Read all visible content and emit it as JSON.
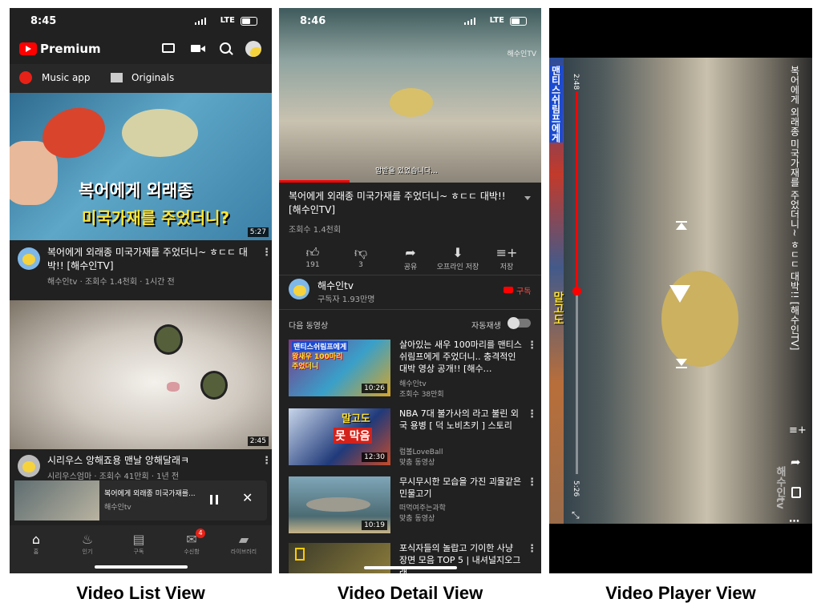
{
  "captions": {
    "list": "Video List View",
    "detail": "Video Detail View",
    "player": "Video Player View"
  },
  "list_view": {
    "time": "8:45",
    "network": "LTE",
    "brand": "Premium",
    "chips": [
      {
        "label": "Music app",
        "icon": "music-icon"
      },
      {
        "label": "Originals",
        "icon": "clapperboard-icon"
      }
    ],
    "videos": [
      {
        "thumb_line1": "복어에게 외래종",
        "thumb_line2": "미국가재를 주었더니?",
        "duration": "5:27",
        "title": "복어에게 외래종 미국가재를 주었더니~ ㅎㄷㄷ 대박!! [해수인TV]",
        "meta": "해수인tv · 조회수 1.4천회 · 1시간 전"
      },
      {
        "duration": "2:45",
        "title": "시리우스 앙해죠용 맨날 앙해달래ㅋ",
        "meta": "시리우스엄마 · 조회수 41만회 · 1년 전"
      }
    ],
    "mini_player": {
      "title": "복어에게 외래종 미국가재를...",
      "channel": "해수인tv"
    },
    "nav": [
      {
        "label": "홈",
        "icon": "home-icon"
      },
      {
        "label": "인기",
        "icon": "trending-icon"
      },
      {
        "label": "구독",
        "icon": "subscriptions-icon"
      },
      {
        "label": "수신함",
        "icon": "inbox-icon",
        "badge": "4"
      },
      {
        "label": "라이브러리",
        "icon": "library-icon"
      }
    ]
  },
  "detail_view": {
    "time": "8:46",
    "network": "LTE",
    "watermark": "해수인TV",
    "subtitle": "압받을 있었습니다...",
    "title": "복어에게 외래종 미국가재를 주었더니~ ㅎㄷㄷ 대박!! [해수인TV]",
    "views": "조회수 1.4천회",
    "actions": [
      {
        "label": "191",
        "icon": "thumbs-up-icon"
      },
      {
        "label": "3",
        "icon": "thumbs-down-icon"
      },
      {
        "label": "공유",
        "icon": "share-icon"
      },
      {
        "label": "오프라인 저장",
        "icon": "download-icon"
      },
      {
        "label": "저장",
        "icon": "playlist-add-icon"
      }
    ],
    "channel": {
      "name": "해수인tv",
      "subs": "구독자 1.93만명",
      "subscribe": "구독"
    },
    "up_next": "다음 동영상",
    "autoplay": "자동재생",
    "next_videos": [
      {
        "title": "살아있는 새우 100마리를 맨티스쉬림프에게 주었더니.. 충격적인 대박 영상 공개!! [해수…",
        "channel": "해수인tv",
        "meta": "조회수 38만회",
        "duration": "10:26",
        "thumb_text": [
          "맨티스쉬림프에게",
          "왕새우 100마리",
          "주었더니"
        ]
      },
      {
        "title": "NBA 7대 불가사의 라고 불린 외국 용병 [ 덕 노비츠키 ] 스토리",
        "channel": "럽볼LoveBall",
        "meta": "맞춤 동영상",
        "duration": "12:30",
        "thumb_text": [
          "말고도",
          "못 막음"
        ]
      },
      {
        "title": "무시무시한 모습을 가진 괴물같은 민물고기",
        "channel": "떠먹여주는과학",
        "meta": "맞춤 동영상",
        "duration": "10:19"
      },
      {
        "title": "포식자들의 놀랍고 기이한 사냥 장면 모음 TOP 5 | 내셔널지오그래…",
        "channel": "",
        "meta": "",
        "duration": ""
      }
    ]
  },
  "player_view": {
    "elapsed": "2:48",
    "total": "5:26",
    "progress": 0.52,
    "title": "복어에게 외래종 미국가재를 주었더니~ ㅎㄷㄷ 대박!! [해수인TV]",
    "watermark": "해수인tv",
    "side_text": [
      "맨티스쉬림프에게",
      "말고도"
    ]
  }
}
